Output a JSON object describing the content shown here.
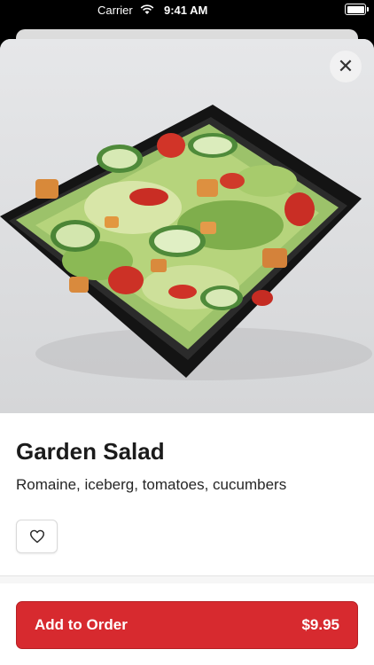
{
  "status_bar": {
    "carrier": "Carrier",
    "time": "9:41 AM"
  },
  "item": {
    "title": "Garden Salad",
    "description": "Romaine, iceberg, tomatoes, cucumbers",
    "image_alt": "garden-salad-photo"
  },
  "actions": {
    "close_icon": "close-icon",
    "favorite_icon": "heart-icon",
    "add_label": "Add to Order",
    "price": "$9.95"
  },
  "colors": {
    "accent": "#d72a2f",
    "background": "#ffffff"
  }
}
